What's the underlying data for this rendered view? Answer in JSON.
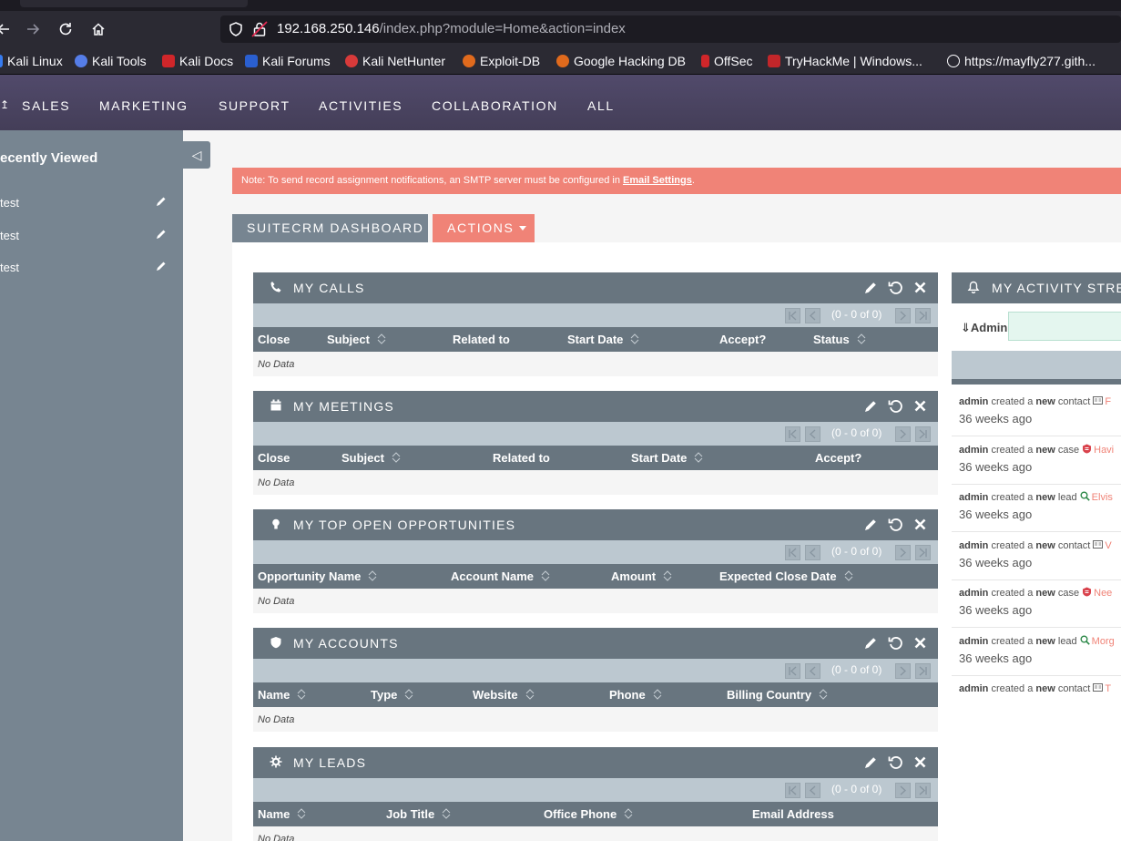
{
  "browser": {
    "url_host": "192.168.250.146",
    "url_path": "/index.php?module=Home&action=index",
    "bookmarks": [
      {
        "label": "Kali Linux",
        "color": "#367bf0"
      },
      {
        "label": "Kali Tools",
        "color": "#557de8"
      },
      {
        "label": "Kali Docs",
        "color": "#d0262a"
      },
      {
        "label": "Kali Forums",
        "color": "#2a5fd0"
      },
      {
        "label": "Kali NetHunter",
        "color": "#d83a3a"
      },
      {
        "label": "Exploit-DB",
        "color": "#e06a1d"
      },
      {
        "label": "Google Hacking DB",
        "color": "#e06a1d"
      },
      {
        "label": "OffSec",
        "color": "#d0262a"
      },
      {
        "label": "TryHackMe | Windows...",
        "color": "#c2262a"
      },
      {
        "label": "https://mayfly277.gith...",
        "color": "#cccccc"
      }
    ]
  },
  "topnav": {
    "items": [
      "SALES",
      "MARKETING",
      "SUPPORT",
      "ACTIVITIES",
      "COLLABORATION",
      "ALL"
    ]
  },
  "sidebar": {
    "title": "ecently Viewed",
    "items": [
      "test",
      "test",
      "test"
    ]
  },
  "notice": {
    "text": "Note: To send record assignment notifications, an SMTP server must be configured in ",
    "link": "Email Settings",
    "suffix": "."
  },
  "tabs": {
    "dashboard": "SUITECRM DASHBOARD",
    "actions": "ACTIONS"
  },
  "dashlets": [
    {
      "title": "MY CALLS",
      "icon": "phone-icon",
      "pager": "(0 - 0 of 0)",
      "columns": [
        "Close",
        "Subject",
        "Related to",
        "Start Date",
        "Accept?",
        "Status"
      ],
      "empty": "No Data"
    },
    {
      "title": "MY MEETINGS",
      "icon": "calendar-icon",
      "pager": "(0 - 0 of 0)",
      "columns": [
        "Close",
        "Subject",
        "Related to",
        "Start Date",
        "Accept?"
      ],
      "empty": "No Data"
    },
    {
      "title": "MY TOP OPEN OPPORTUNITIES",
      "icon": "lightbulb-icon",
      "pager": "(0 - 0 of 0)",
      "columns": [
        "Opportunity Name",
        "Account Name",
        "Amount",
        "Expected Close Date"
      ],
      "empty": "No Data"
    },
    {
      "title": "MY ACCOUNTS",
      "icon": "shield-icon",
      "pager": "(0 - 0 of 0)",
      "columns": [
        "Name",
        "Type",
        "Website",
        "Phone",
        "Billing Country"
      ],
      "empty": "No Data"
    },
    {
      "title": "MY LEADS",
      "icon": "gear-icon",
      "pager": "(0 - 0 of 0)",
      "columns": [
        "Name",
        "Job Title",
        "Office Phone",
        "Email Address"
      ],
      "empty": "No Data"
    }
  ],
  "activity": {
    "title": "MY ACTIVITY STREAM",
    "user": "Admin",
    "entries": [
      {
        "actor": "admin",
        "verb": "created a",
        "adj": "new",
        "type": "contact",
        "icon": "contact-icon",
        "record": "F",
        "when": "36 weeks ago"
      },
      {
        "actor": "admin",
        "verb": "created a",
        "adj": "new",
        "type": "case",
        "icon": "case-icon",
        "record": "Havi",
        "when": "36 weeks ago"
      },
      {
        "actor": "admin",
        "verb": "created a",
        "adj": "new",
        "type": "lead",
        "icon": "lead-icon",
        "record": "Elvis",
        "when": "36 weeks ago"
      },
      {
        "actor": "admin",
        "verb": "created a",
        "adj": "new",
        "type": "contact",
        "icon": "contact-icon",
        "record": "V",
        "when": "36 weeks ago"
      },
      {
        "actor": "admin",
        "verb": "created a",
        "adj": "new",
        "type": "case",
        "icon": "case-icon",
        "record": "Nee",
        "when": "36 weeks ago"
      },
      {
        "actor": "admin",
        "verb": "created a",
        "adj": "new",
        "type": "lead",
        "icon": "lead-icon",
        "record": "Morg",
        "when": "36 weeks ago"
      },
      {
        "actor": "admin",
        "verb": "created a",
        "adj": "new",
        "type": "contact",
        "icon": "contact-icon",
        "record": "T",
        "when": ""
      }
    ]
  }
}
